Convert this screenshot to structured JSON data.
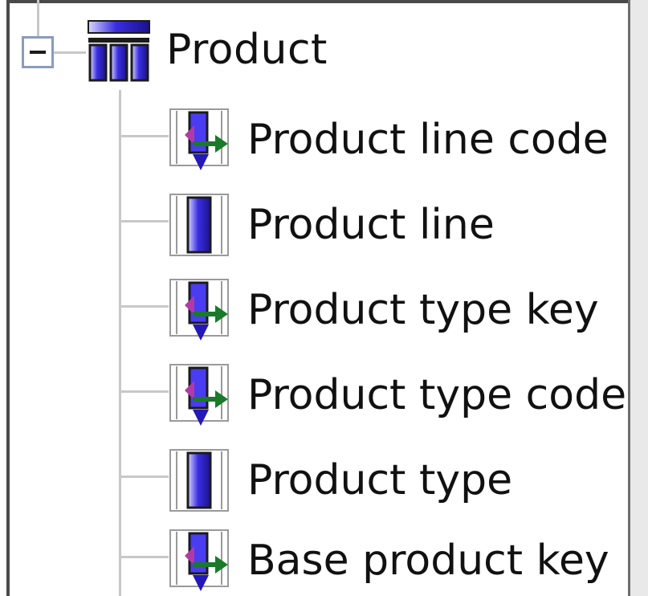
{
  "tree": {
    "root": {
      "label": "Product",
      "icon": "dimension-icon",
      "expanded": true
    },
    "children": [
      {
        "label": "Product line code",
        "icon": "key-attribute-icon"
      },
      {
        "label": "Product line",
        "icon": "attribute-icon"
      },
      {
        "label": "Product type key",
        "icon": "key-attribute-icon"
      },
      {
        "label": "Product type code",
        "icon": "key-attribute-icon"
      },
      {
        "label": "Product type",
        "icon": "attribute-icon"
      },
      {
        "label": "Base product key",
        "icon": "key-attribute-icon"
      }
    ]
  },
  "colors": {
    "icon_blue": "#2418b8",
    "icon_magenta": "#b23aa8",
    "icon_green": "#1a7a2a",
    "tree_line": "#c8c8c8"
  }
}
